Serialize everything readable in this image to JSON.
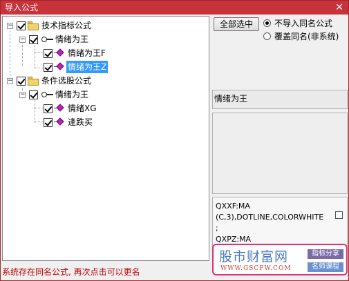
{
  "window": {
    "title": "导入公式",
    "close_glyph": "✕"
  },
  "tree": {
    "groups": [
      {
        "label": "技术指标公式",
        "expander": "−",
        "checked": true,
        "children": [
          {
            "label": "情绪为王",
            "expander": "−",
            "checked": true,
            "items": [
              {
                "label": "情绪为王F",
                "checked": true,
                "selected": false
              },
              {
                "label": "情绪为王Z",
                "checked": true,
                "selected": true
              }
            ]
          }
        ]
      },
      {
        "label": "条件选股公式",
        "expander": "−",
        "checked": true,
        "children": [
          {
            "label": "情绪为王",
            "expander": "−",
            "checked": true,
            "items": [
              {
                "label": "情绪XG",
                "checked": true,
                "selected": false
              },
              {
                "label": "逢跌买",
                "checked": true,
                "selected": false
              }
            ]
          }
        ]
      }
    ]
  },
  "actions": {
    "select_all_label": "全部选中"
  },
  "options": {
    "no_import_label": "不导入同名公式",
    "overwrite_label": "覆盖同名(非系统)",
    "selected": "no_import"
  },
  "detail": {
    "name": "情绪为王",
    "description": "",
    "code_lines": [
      "QXXF:MA",
      "(C,3),DOTLINE,COLORWHITE",
      ";",
      "QXPZ:MA"
    ]
  },
  "status": {
    "message": "系统存在同名公式, 再次点击可以更名"
  },
  "watermark": {
    "title": "股市财富网",
    "url": "WWW.GSCFW.COM",
    "tag1": "指标分享",
    "tag2": "名师课程"
  },
  "colors": {
    "titlebar": "#c8323a",
    "selection": "#3399ff",
    "status_text": "#c00000"
  }
}
